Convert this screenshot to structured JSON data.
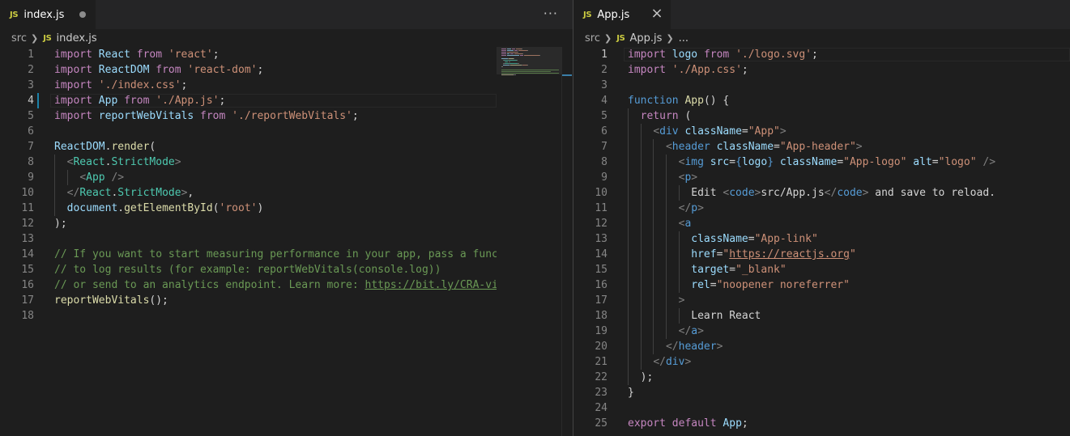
{
  "left_editor": {
    "tab": {
      "badge": "JS",
      "name": "index.js"
    },
    "more_actions": "···",
    "breadcrumb": {
      "folder": "src",
      "badge": "JS",
      "file": "index.js"
    },
    "active_line": 4,
    "lines": [
      {
        "n": "1",
        "tokens": [
          [
            "kw",
            "import"
          ],
          [
            "txt",
            " "
          ],
          [
            "id",
            "React"
          ],
          [
            "txt",
            " "
          ],
          [
            "kw",
            "from"
          ],
          [
            "txt",
            " "
          ],
          [
            "str",
            "'react'"
          ],
          [
            "txt",
            ";"
          ]
        ]
      },
      {
        "n": "2",
        "tokens": [
          [
            "kw",
            "import"
          ],
          [
            "txt",
            " "
          ],
          [
            "id",
            "ReactDOM"
          ],
          [
            "txt",
            " "
          ],
          [
            "kw",
            "from"
          ],
          [
            "txt",
            " "
          ],
          [
            "str",
            "'react-dom'"
          ],
          [
            "txt",
            ";"
          ]
        ]
      },
      {
        "n": "3",
        "tokens": [
          [
            "kw",
            "import"
          ],
          [
            "txt",
            " "
          ],
          [
            "str",
            "'./index.css'"
          ],
          [
            "txt",
            ";"
          ]
        ]
      },
      {
        "n": "4",
        "tokens": [
          [
            "kw",
            "import"
          ],
          [
            "txt",
            " "
          ],
          [
            "id",
            "App"
          ],
          [
            "txt",
            " "
          ],
          [
            "kw",
            "from"
          ],
          [
            "txt",
            " "
          ],
          [
            "str",
            "'./App.js'"
          ],
          [
            "txt",
            ";"
          ]
        ]
      },
      {
        "n": "5",
        "tokens": [
          [
            "kw",
            "import"
          ],
          [
            "txt",
            " "
          ],
          [
            "id",
            "reportWebVitals"
          ],
          [
            "txt",
            " "
          ],
          [
            "kw",
            "from"
          ],
          [
            "txt",
            " "
          ],
          [
            "str",
            "'./reportWebVitals'"
          ],
          [
            "txt",
            ";"
          ]
        ]
      },
      {
        "n": "6",
        "tokens": []
      },
      {
        "n": "7",
        "tokens": [
          [
            "id",
            "ReactDOM"
          ],
          [
            "txt",
            "."
          ],
          [
            "fn",
            "render"
          ],
          [
            "txt",
            "("
          ]
        ]
      },
      {
        "n": "8",
        "tokens": [
          [
            "txt",
            "  "
          ],
          [
            "punc",
            "<"
          ],
          [
            "comp",
            "React"
          ],
          [
            "txt",
            "."
          ],
          [
            "comp",
            "StrictMode"
          ],
          [
            "punc",
            ">"
          ]
        ]
      },
      {
        "n": "9",
        "tokens": [
          [
            "txt",
            "    "
          ],
          [
            "punc",
            "<"
          ],
          [
            "comp",
            "App"
          ],
          [
            "txt",
            " "
          ],
          [
            "punc",
            "/>"
          ]
        ]
      },
      {
        "n": "10",
        "tokens": [
          [
            "txt",
            "  "
          ],
          [
            "punc",
            "</"
          ],
          [
            "comp",
            "React"
          ],
          [
            "txt",
            "."
          ],
          [
            "comp",
            "StrictMode"
          ],
          [
            "punc",
            ">"
          ],
          [
            "txt",
            ","
          ]
        ]
      },
      {
        "n": "11",
        "tokens": [
          [
            "txt",
            "  "
          ],
          [
            "id",
            "document"
          ],
          [
            "txt",
            "."
          ],
          [
            "fn",
            "getElementById"
          ],
          [
            "txt",
            "("
          ],
          [
            "str",
            "'root'"
          ],
          [
            "txt",
            ")"
          ]
        ]
      },
      {
        "n": "12",
        "tokens": [
          [
            "txt",
            ");"
          ]
        ]
      },
      {
        "n": "13",
        "tokens": []
      },
      {
        "n": "14",
        "tokens": [
          [
            "cm",
            "// If you want to start measuring performance in your app, pass a funct"
          ]
        ]
      },
      {
        "n": "15",
        "tokens": [
          [
            "cm",
            "// to log results (for example: reportWebVitals(console.log))"
          ]
        ]
      },
      {
        "n": "16",
        "tokens": [
          [
            "cm",
            "// or send to an analytics endpoint. Learn more: "
          ],
          [
            "link",
            "https://bit.ly/CRA-vit"
          ]
        ]
      },
      {
        "n": "17",
        "tokens": [
          [
            "fn",
            "reportWebVitals"
          ],
          [
            "txt",
            "();"
          ]
        ]
      },
      {
        "n": "18",
        "tokens": []
      }
    ]
  },
  "right_editor": {
    "tab": {
      "badge": "JS",
      "name": "App.js",
      "close": "×"
    },
    "breadcrumb": {
      "folder": "src",
      "badge": "JS",
      "file": "App.js",
      "more": "..."
    },
    "active_line": 1,
    "lines": [
      {
        "n": "1",
        "tokens": [
          [
            "kw",
            "import"
          ],
          [
            "txt",
            " "
          ],
          [
            "id",
            "logo"
          ],
          [
            "txt",
            " "
          ],
          [
            "kw",
            "from"
          ],
          [
            "txt",
            " "
          ],
          [
            "str",
            "'./logo.svg'"
          ],
          [
            "txt",
            ";"
          ]
        ]
      },
      {
        "n": "2",
        "tokens": [
          [
            "kw",
            "import"
          ],
          [
            "txt",
            " "
          ],
          [
            "str",
            "'./App.css'"
          ],
          [
            "txt",
            ";"
          ]
        ]
      },
      {
        "n": "3",
        "tokens": []
      },
      {
        "n": "4",
        "tokens": [
          [
            "blue",
            "function"
          ],
          [
            "txt",
            " "
          ],
          [
            "fn",
            "App"
          ],
          [
            "txt",
            "() {"
          ]
        ]
      },
      {
        "n": "5",
        "tokens": [
          [
            "txt",
            "  "
          ],
          [
            "kw",
            "return"
          ],
          [
            "txt",
            " ("
          ]
        ]
      },
      {
        "n": "6",
        "tokens": [
          [
            "txt",
            "    "
          ],
          [
            "punc",
            "<"
          ],
          [
            "tag",
            "div"
          ],
          [
            "txt",
            " "
          ],
          [
            "attr",
            "className"
          ],
          [
            "txt",
            "="
          ],
          [
            "str",
            "\"App\""
          ],
          [
            "punc",
            ">"
          ]
        ]
      },
      {
        "n": "7",
        "tokens": [
          [
            "txt",
            "      "
          ],
          [
            "punc",
            "<"
          ],
          [
            "tag",
            "header"
          ],
          [
            "txt",
            " "
          ],
          [
            "attr",
            "className"
          ],
          [
            "txt",
            "="
          ],
          [
            "str",
            "\"App-header\""
          ],
          [
            "punc",
            ">"
          ]
        ]
      },
      {
        "n": "8",
        "tokens": [
          [
            "txt",
            "        "
          ],
          [
            "punc",
            "<"
          ],
          [
            "tag",
            "img"
          ],
          [
            "txt",
            " "
          ],
          [
            "attr",
            "src"
          ],
          [
            "txt",
            "="
          ],
          [
            "blue",
            "{"
          ],
          [
            "id",
            "logo"
          ],
          [
            "blue",
            "}"
          ],
          [
            "txt",
            " "
          ],
          [
            "attr",
            "className"
          ],
          [
            "txt",
            "="
          ],
          [
            "str",
            "\"App-logo\""
          ],
          [
            "txt",
            " "
          ],
          [
            "attr",
            "alt"
          ],
          [
            "txt",
            "="
          ],
          [
            "str",
            "\"logo\""
          ],
          [
            "txt",
            " "
          ],
          [
            "punc",
            "/>"
          ]
        ]
      },
      {
        "n": "9",
        "tokens": [
          [
            "txt",
            "        "
          ],
          [
            "punc",
            "<"
          ],
          [
            "tag",
            "p"
          ],
          [
            "punc",
            ">"
          ]
        ]
      },
      {
        "n": "10",
        "tokens": [
          [
            "txt",
            "          Edit "
          ],
          [
            "punc",
            "<"
          ],
          [
            "tag",
            "code"
          ],
          [
            "punc",
            ">"
          ],
          [
            "txt",
            "src/App.js"
          ],
          [
            "punc",
            "</"
          ],
          [
            "tag",
            "code"
          ],
          [
            "punc",
            ">"
          ],
          [
            "txt",
            " and save to reload."
          ]
        ]
      },
      {
        "n": "11",
        "tokens": [
          [
            "txt",
            "        "
          ],
          [
            "punc",
            "</"
          ],
          [
            "tag",
            "p"
          ],
          [
            "punc",
            ">"
          ]
        ]
      },
      {
        "n": "12",
        "tokens": [
          [
            "txt",
            "        "
          ],
          [
            "punc",
            "<"
          ],
          [
            "tag",
            "a"
          ]
        ]
      },
      {
        "n": "13",
        "tokens": [
          [
            "txt",
            "          "
          ],
          [
            "attr",
            "className"
          ],
          [
            "txt",
            "="
          ],
          [
            "str",
            "\"App-link\""
          ]
        ]
      },
      {
        "n": "14",
        "tokens": [
          [
            "txt",
            "          "
          ],
          [
            "attr",
            "href"
          ],
          [
            "txt",
            "="
          ],
          [
            "str",
            "\""
          ],
          [
            "strlink",
            "https://reactjs.org"
          ],
          [
            "str",
            "\""
          ]
        ]
      },
      {
        "n": "15",
        "tokens": [
          [
            "txt",
            "          "
          ],
          [
            "attr",
            "target"
          ],
          [
            "txt",
            "="
          ],
          [
            "str",
            "\"_blank\""
          ]
        ]
      },
      {
        "n": "16",
        "tokens": [
          [
            "txt",
            "          "
          ],
          [
            "attr",
            "rel"
          ],
          [
            "txt",
            "="
          ],
          [
            "str",
            "\"noopener noreferrer\""
          ]
        ]
      },
      {
        "n": "17",
        "tokens": [
          [
            "txt",
            "        "
          ],
          [
            "punc",
            ">"
          ]
        ]
      },
      {
        "n": "18",
        "tokens": [
          [
            "txt",
            "          Learn React"
          ]
        ]
      },
      {
        "n": "19",
        "tokens": [
          [
            "txt",
            "        "
          ],
          [
            "punc",
            "</"
          ],
          [
            "tag",
            "a"
          ],
          [
            "punc",
            ">"
          ]
        ]
      },
      {
        "n": "20",
        "tokens": [
          [
            "txt",
            "      "
          ],
          [
            "punc",
            "</"
          ],
          [
            "tag",
            "header"
          ],
          [
            "punc",
            ">"
          ]
        ]
      },
      {
        "n": "21",
        "tokens": [
          [
            "txt",
            "    "
          ],
          [
            "punc",
            "</"
          ],
          [
            "tag",
            "div"
          ],
          [
            "punc",
            ">"
          ]
        ]
      },
      {
        "n": "22",
        "tokens": [
          [
            "txt",
            "  );"
          ]
        ]
      },
      {
        "n": "23",
        "tokens": [
          [
            "txt",
            "}"
          ]
        ]
      },
      {
        "n": "24",
        "tokens": []
      },
      {
        "n": "25",
        "tokens": [
          [
            "kw",
            "export"
          ],
          [
            "txt",
            " "
          ],
          [
            "kw",
            "default"
          ],
          [
            "txt",
            " "
          ],
          [
            "id",
            "App"
          ],
          [
            "txt",
            ";"
          ]
        ]
      }
    ]
  },
  "colors": {
    "background": "#1e1e1e",
    "tab_bar": "#252526",
    "keyword": "#c586c0",
    "variable": "#9cdcfe",
    "function": "#dcdcaa",
    "string": "#ce9178",
    "tag": "#569cd6",
    "component": "#4ec9b0",
    "comment": "#6a9955",
    "js_badge": "#cbcb41"
  }
}
